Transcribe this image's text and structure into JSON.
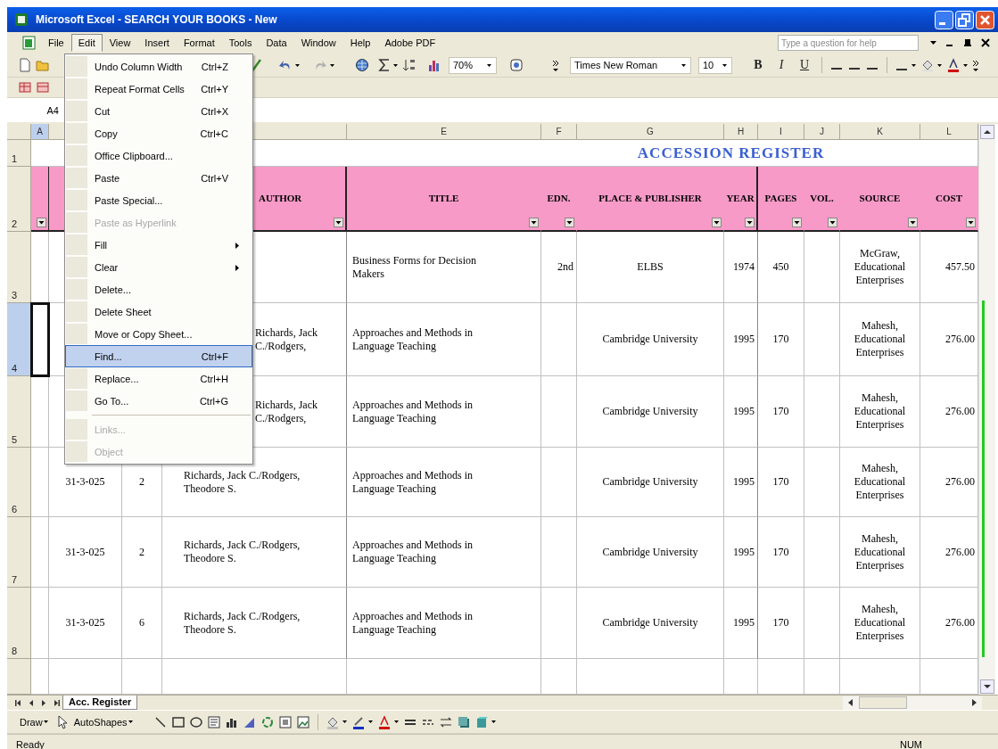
{
  "window": {
    "title": "Microsoft Excel - SEARCH YOUR BOOKS - New"
  },
  "menu_bar": [
    {
      "label": "File",
      "selected": false
    },
    {
      "label": "Edit",
      "selected": true
    },
    {
      "label": "View",
      "selected": false
    },
    {
      "label": "Insert",
      "selected": false
    },
    {
      "label": "Format",
      "selected": false
    },
    {
      "label": "Tools",
      "selected": false
    },
    {
      "label": "Data",
      "selected": false
    },
    {
      "label": "Window",
      "selected": false
    },
    {
      "label": "Help",
      "selected": false
    },
    {
      "label": "Adobe PDF",
      "selected": false
    }
  ],
  "help_search": {
    "placeholder": "Type a question for help"
  },
  "formatting": {
    "zoom": "70%",
    "font": "Times New Roman",
    "font_size": "10",
    "bold": "B",
    "italic": "I",
    "underline": "U"
  },
  "name_box": {
    "value": "A4"
  },
  "edit_menu": [
    {
      "label": "Undo Column Width",
      "shortcut": "Ctrl+Z",
      "disabled": false,
      "selected": false,
      "submenu": false,
      "separator_before": false
    },
    {
      "label": "Repeat Format Cells",
      "shortcut": "Ctrl+Y",
      "disabled": false,
      "selected": false,
      "submenu": false,
      "separator_before": false
    },
    {
      "label": "Cut",
      "shortcut": "Ctrl+X",
      "disabled": false,
      "selected": false,
      "submenu": false,
      "separator_before": false
    },
    {
      "label": "Copy",
      "shortcut": "Ctrl+C",
      "disabled": false,
      "selected": false,
      "submenu": false,
      "separator_before": false
    },
    {
      "label": "Office Clipboard...",
      "disabled": false,
      "selected": false,
      "submenu": false,
      "separator_before": false
    },
    {
      "label": "Paste",
      "shortcut": "Ctrl+V",
      "disabled": false,
      "selected": false,
      "submenu": false,
      "separator_before": false
    },
    {
      "label": "Paste Special...",
      "disabled": false,
      "selected": false,
      "submenu": false,
      "separator_before": false
    },
    {
      "label": "Paste as Hyperlink",
      "disabled": true,
      "selected": false,
      "submenu": false,
      "separator_before": false
    },
    {
      "label": "Fill",
      "disabled": false,
      "selected": false,
      "submenu": true,
      "separator_before": false
    },
    {
      "label": "Clear",
      "disabled": false,
      "selected": false,
      "submenu": true,
      "separator_before": false
    },
    {
      "label": "Delete...",
      "disabled": false,
      "selected": false,
      "submenu": false,
      "separator_before": false
    },
    {
      "label": "Delete Sheet",
      "disabled": false,
      "selected": false,
      "submenu": false,
      "separator_before": false
    },
    {
      "label": "Move or Copy Sheet...",
      "disabled": false,
      "selected": false,
      "submenu": false,
      "separator_before": false
    },
    {
      "label": "Find...",
      "shortcut": "Ctrl+F",
      "disabled": false,
      "selected": true,
      "submenu": false,
      "separator_before": false
    },
    {
      "label": "Replace...",
      "shortcut": "Ctrl+H",
      "disabled": false,
      "selected": false,
      "submenu": false,
      "separator_before": false
    },
    {
      "label": "Go To...",
      "shortcut": "Ctrl+G",
      "disabled": false,
      "selected": false,
      "submenu": false,
      "separator_before": false
    },
    {
      "label": "Links...",
      "disabled": true,
      "selected": false,
      "submenu": false,
      "separator_before": true
    },
    {
      "label": "Object",
      "disabled": true,
      "selected": false,
      "submenu": false,
      "separator_before": false
    }
  ],
  "sheet": {
    "title": "ACCESSION REGISTER",
    "column_headers": {
      "A": {
        "label": "A",
        "selected": true
      },
      "E": {
        "label": "E",
        "selected": false
      },
      "F": {
        "label": "F",
        "selected": false
      },
      "G": {
        "label": "G",
        "selected": false
      },
      "H": {
        "label": "H",
        "selected": false
      },
      "I": {
        "label": "I",
        "selected": false
      },
      "J": {
        "label": "J",
        "selected": false
      },
      "K": {
        "label": "K",
        "selected": false
      },
      "L": {
        "label": "L",
        "selected": false
      }
    },
    "title_row": {
      "label": "1",
      "selected": false
    },
    "header_row": {
      "label": "2",
      "selected": false,
      "autofilter": true,
      "cells": {
        "D": "AUTHOR",
        "E": "TITLE",
        "F": "EDN.",
        "G": "PLACE & PUBLISHER",
        "H": "YEAR",
        "I": "PAGES",
        "J": "VOL.",
        "K": "SOURCE",
        "L": "COST"
      }
    },
    "rows": [
      {
        "label": "3",
        "selected": false,
        "cells": {
          "E": "Business Forms for Decision Makers",
          "F": "2nd",
          "G": "ELBS",
          "H": "1974",
          "I": "450",
          "K": "McGraw, Educational Enterprises",
          "L": "457.50"
        }
      },
      {
        "label": "4",
        "selected": true,
        "cells": {
          "D": "Richards, Jack C./Rodgers,",
          "E": "Approaches and Methods in Language Teaching",
          "G": "Cambridge University",
          "H": "1995",
          "I": "170",
          "K": "Mahesh, Educational Enterprises",
          "L": "276.00"
        }
      },
      {
        "label": "5",
        "selected": false,
        "cells": {
          "D": "Richards, Jack C./Rodgers,",
          "E": "Approaches and Methods in Language Teaching",
          "G": "Cambridge University",
          "H": "1995",
          "I": "170",
          "K": "Mahesh, Educational Enterprises",
          "L": "276.00"
        }
      },
      {
        "label": "6",
        "selected": false,
        "cells": {
          "B": "31-3-025",
          "C": "2",
          "D": "Richards, Jack C./Rodgers, Theodore S.",
          "E": "Approaches and Methods in Language Teaching",
          "G": "Cambridge University",
          "H": "1995",
          "I": "170",
          "K": "Mahesh, Educational Enterprises",
          "L": "276.00"
        }
      },
      {
        "label": "7",
        "selected": false,
        "cells": {
          "B": "31-3-025",
          "C": "2",
          "D": "Richards, Jack C./Rodgers, Theodore S.",
          "E": "Approaches and Methods in Language Teaching",
          "G": "Cambridge University",
          "H": "1995",
          "I": "170",
          "K": "Mahesh, Educational Enterprises",
          "L": "276.00"
        }
      },
      {
        "label": "8",
        "selected": false,
        "cells": {
          "B": "31-3-025",
          "C": "6",
          "D": "Richards, Jack C./Rodgers, Theodore S.",
          "E": "Approaches and Methods in Language Teaching",
          "G": "Cambridge University",
          "H": "1995",
          "I": "170",
          "K": "Mahesh, Educational Enterprises",
          "L": "276.00"
        }
      }
    ]
  },
  "sheet_tabs": [
    {
      "label": "Acc. Register",
      "selected": true
    }
  ],
  "draw_toolbar": {
    "draw": "Draw",
    "autoshapes": "AutoShapes"
  },
  "status_bar": {
    "status": "Ready",
    "indicator": "NUM"
  }
}
